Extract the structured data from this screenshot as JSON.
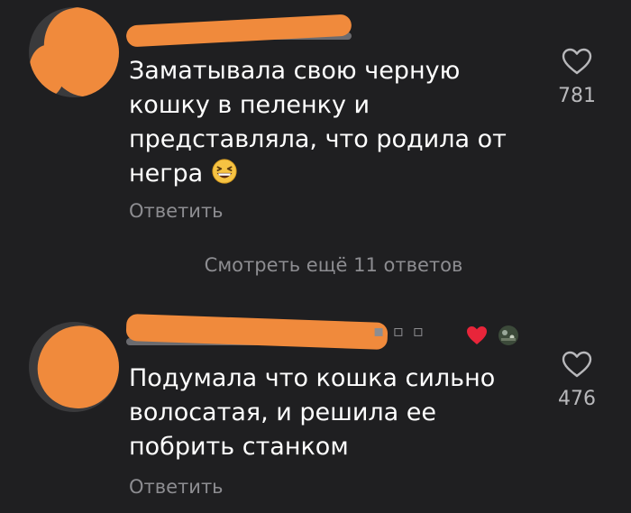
{
  "comments": [
    {
      "text": "Заматывала свою черную\nкошку в пеленку и\nпредставляла, что родила от\nнегра",
      "emoji": "grinning-squinting-face-emoji",
      "reply_label": "Ответить",
      "likes": "781",
      "author_liked": false
    },
    {
      "text": "Подумала что кошка сильно\nволосатая, и решила ее\nпобрить станком",
      "reply_label": "Ответить",
      "likes": "476",
      "author_liked": true
    }
  ],
  "more_replies_label": "Смотреть ещё 11 ответов",
  "colors": {
    "background": "#1f1f21",
    "redaction": "#f08a3c",
    "muted_text": "#8d8d91",
    "heart_red": "#e8253a"
  },
  "icons": {
    "like": "heart-outline-icon",
    "author_liked": "heart-filled-icon"
  }
}
